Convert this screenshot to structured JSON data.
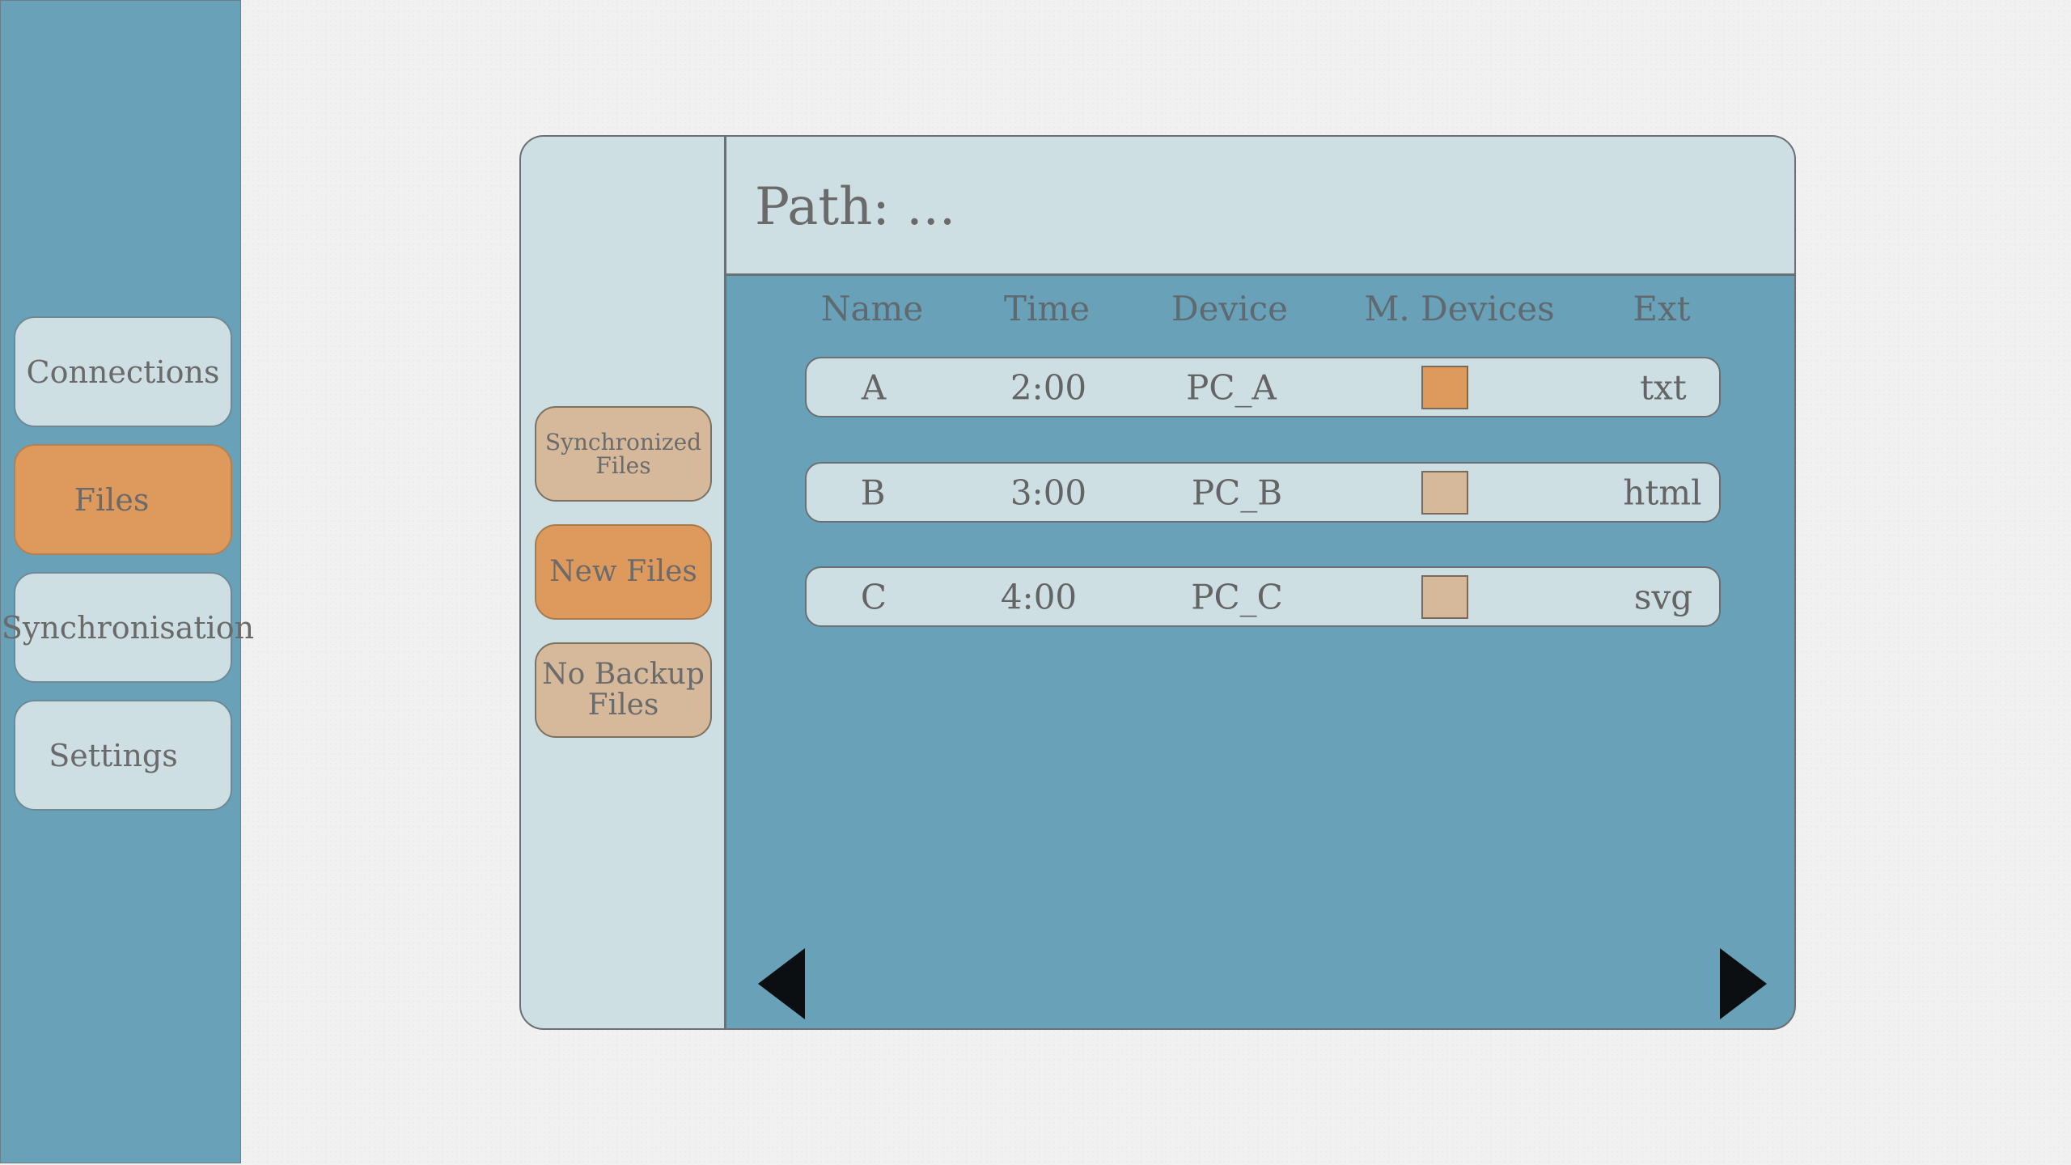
{
  "sidebar": {
    "items": [
      {
        "label": "Connections",
        "active": false
      },
      {
        "label": "Files",
        "active": true
      },
      {
        "label": "Synchronisation",
        "active": false
      },
      {
        "label": "Settings",
        "active": false
      }
    ]
  },
  "filters": {
    "items": [
      {
        "label_line1": "Synchronized",
        "label_line2": "Files",
        "active": false
      },
      {
        "label": "New Files",
        "active": true
      },
      {
        "label_line1": "No Backup",
        "label_line2": "Files",
        "active": false
      }
    ]
  },
  "path": {
    "label": "Path: ..."
  },
  "table": {
    "columns": [
      "Name",
      "Time",
      "Device",
      "M. Devices",
      "Ext"
    ],
    "rows": [
      {
        "name": "A",
        "time": "2:00",
        "device": "PC_A",
        "ext": "txt",
        "marker_color": "#de9a5c"
      },
      {
        "name": "B",
        "time": "3:00",
        "device": "PC_B",
        "ext": "html",
        "marker_color": "#d6b99b"
      },
      {
        "name": "C",
        "time": "4:00",
        "device": "PC_C",
        "ext": "svg",
        "marker_color": "#d6b99b"
      }
    ]
  },
  "navigation": {
    "prev_icon": "triangle-left",
    "next_icon": "triangle-right"
  },
  "colors": {
    "sidebar_bg": "#68a1b8",
    "light_panel": "#cddfe3",
    "accent_orange": "#de9a5c",
    "tan": "#d6b99b"
  }
}
